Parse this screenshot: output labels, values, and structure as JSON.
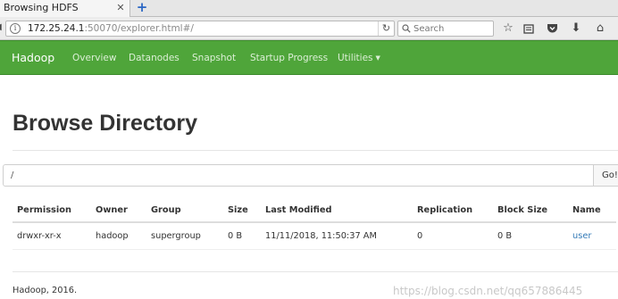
{
  "browser": {
    "tab_title": "Browsing HDFS",
    "tab_close_icon": "close-icon",
    "new_tab_icon": "plus-icon",
    "url_host": "172.25.24.1",
    "url_rest": ":50070/explorer.html#/",
    "search_placeholder": "Search",
    "toolbar_icons": [
      "star-icon",
      "reading-list-icon",
      "pocket-icon",
      "download-icon",
      "home-icon"
    ]
  },
  "hadoop_nav": {
    "brand": "Hadoop",
    "items": [
      "Overview",
      "Datanodes",
      "Snapshot",
      "Startup Progress",
      "Utilities"
    ],
    "accent_color": "#4fa53a"
  },
  "page": {
    "title": "Browse Directory",
    "path_value": "/",
    "go_label": "Go!"
  },
  "table": {
    "headers": [
      "Permission",
      "Owner",
      "Group",
      "Size",
      "Last Modified",
      "Replication",
      "Block Size",
      "Name"
    ],
    "rows": [
      [
        "drwxr-xr-x",
        "hadoop",
        "supergroup",
        "0 B",
        "11/11/2018, 11:50:37 AM",
        "0",
        "0 B",
        "user"
      ]
    ]
  },
  "footer": {
    "text": "Hadoop, 2016."
  },
  "watermark": "https://blog.csdn.net/qq657886445"
}
